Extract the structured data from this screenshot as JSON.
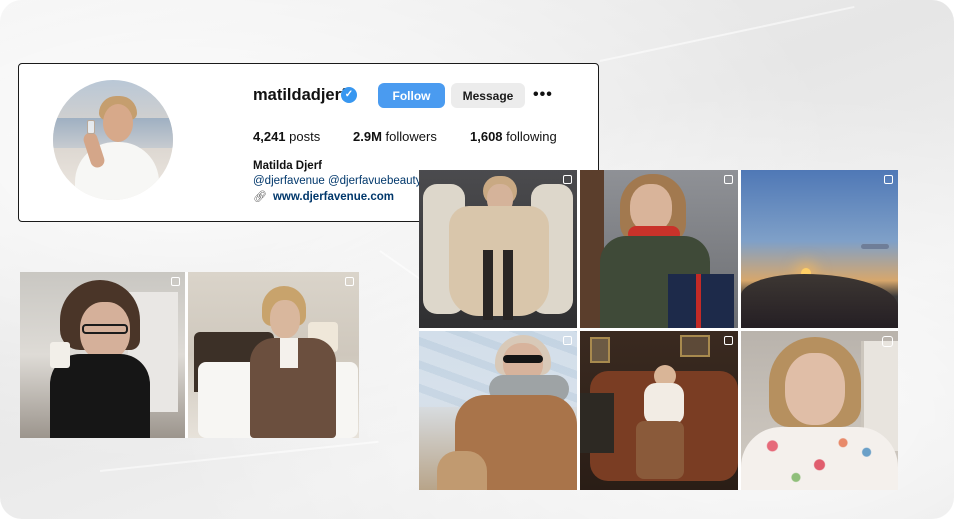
{
  "profile": {
    "username": "matildadjerf",
    "verified_glyph": "✓",
    "follow_label": "Follow",
    "message_label": "Message",
    "more_glyph": "•••",
    "stats": {
      "posts_count": "4,241",
      "posts_label": " posts",
      "followers_count": "2.9M",
      "followers_label": " followers",
      "following_count": "1,608",
      "following_label": " following"
    },
    "full_name": "Matilda Djerf",
    "mentions": "@djerfavenue @djerfavuebeauty",
    "link_glyph": "🔗",
    "link_text": "www.djerfavenue.com"
  },
  "icons": {
    "verified": "verified-badge-icon",
    "more": "more-options-icon",
    "link": "link-icon",
    "multi_photo": "multiple-photos-icon",
    "reel": "reel-icon"
  },
  "colors": {
    "follow_button": "#4a9bf0",
    "message_button": "#ececec",
    "verified": "#3897f0",
    "link": "#00376b"
  },
  "left_grid": {
    "tiles": [
      "photo-woman-glasses-coffee",
      "photo-woman-brown-blazer-bed"
    ]
  },
  "right_grid": {
    "tiles": [
      "photo-woman-car-seat-coat",
      "photo-woman-red-scarf-box",
      "photo-sunset-landscape",
      "photo-woman-sunglasses-plane",
      "photo-woman-leather-sofa",
      "photo-woman-floral-robe"
    ]
  }
}
